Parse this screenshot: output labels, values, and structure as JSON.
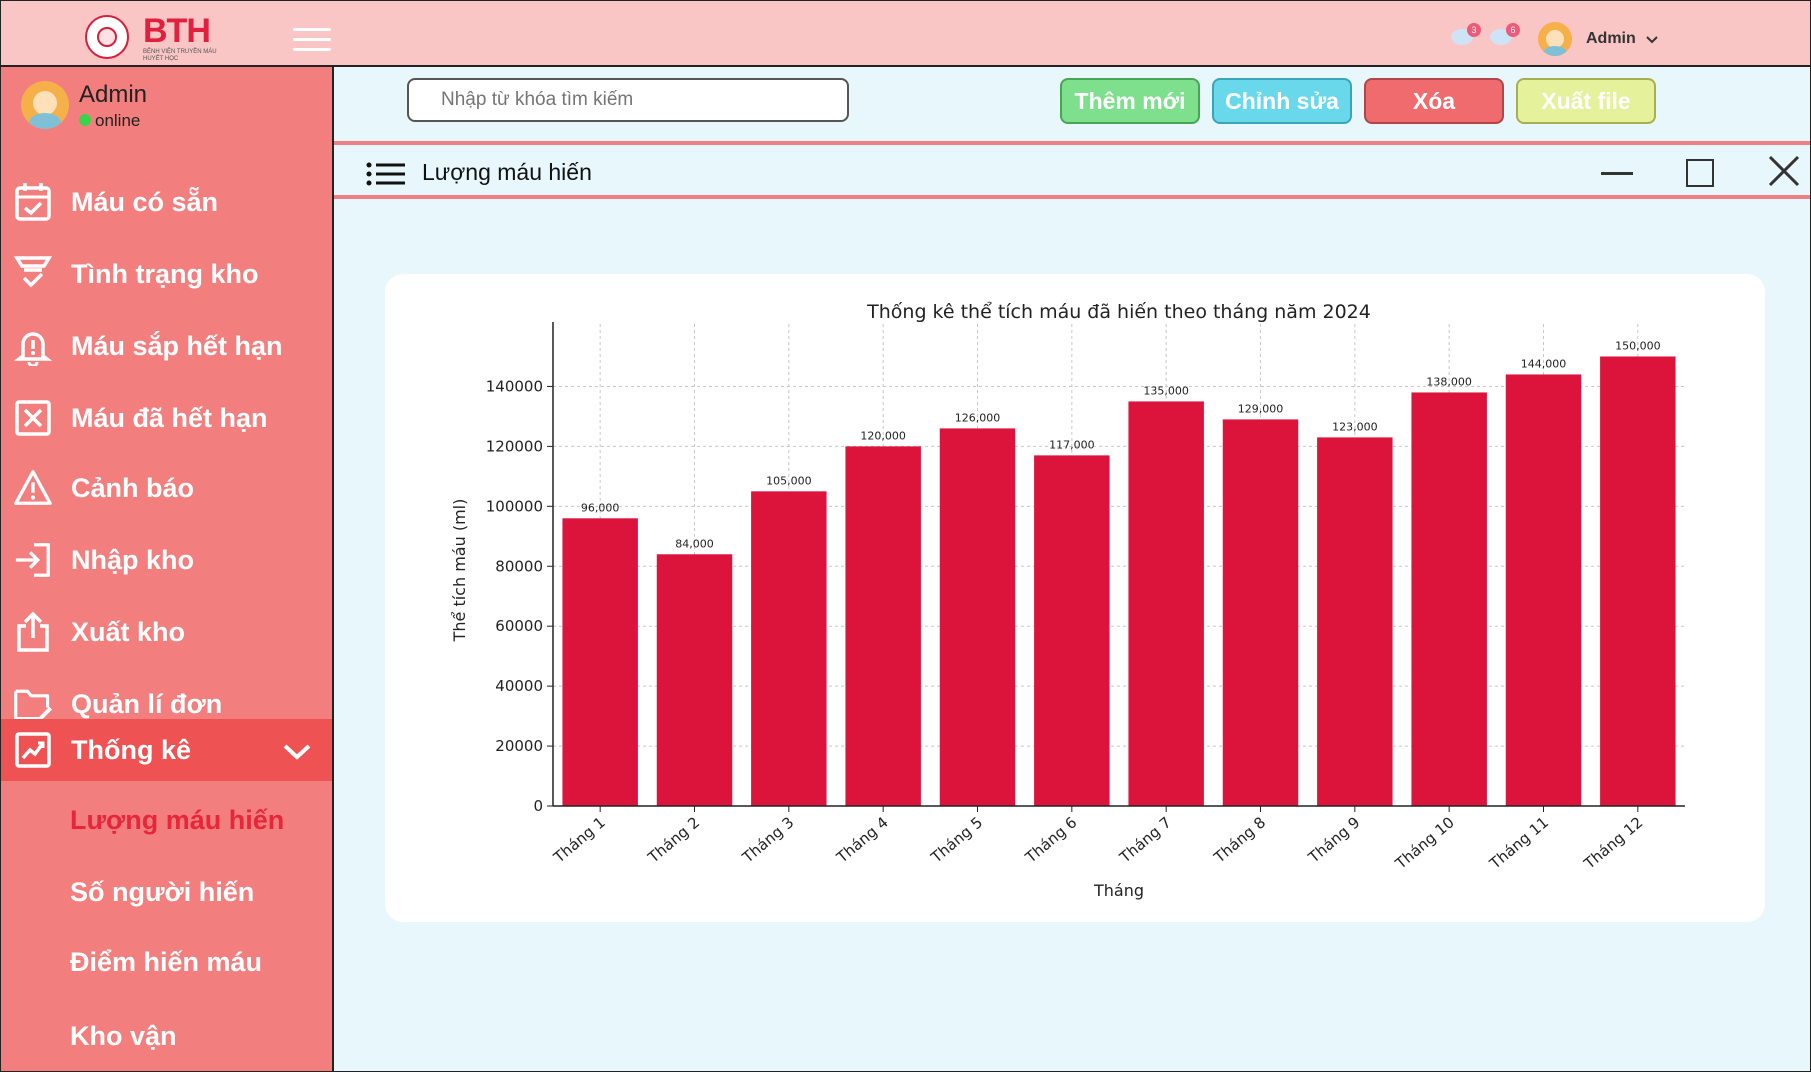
{
  "topbar": {
    "logo_text": "BTH",
    "logo_subtitle": "BỆNH VIỆN TRUYỀN MÁU HUYẾT HỌC",
    "notifications": [
      {
        "count": "3"
      },
      {
        "count": "6"
      }
    ],
    "user_name": "Admin"
  },
  "sidebar": {
    "profile": {
      "name": "Admin",
      "status": "online"
    },
    "items": [
      {
        "label": "Máu có sẵn",
        "icon": "calendar-check-icon"
      },
      {
        "label": "Tình trạng kho",
        "icon": "funnel-check-icon"
      },
      {
        "label": "Máu sắp hết hạn",
        "icon": "bell-alert-icon"
      },
      {
        "label": "Máu đã hết hạn",
        "icon": "x-square-icon"
      },
      {
        "label": "Cảnh báo",
        "icon": "warning-icon"
      },
      {
        "label": "Nhập kho",
        "icon": "import-icon"
      },
      {
        "label": "Xuất kho",
        "icon": "export-icon"
      },
      {
        "label": "Quản lí đơn",
        "icon": "folder-edit-icon"
      },
      {
        "label": "Thống kê",
        "icon": "chart-icon"
      }
    ],
    "subitems": [
      {
        "label": "Lượng máu hiến"
      },
      {
        "label": "Số người hiến"
      },
      {
        "label": "Điểm hiến máu"
      },
      {
        "label": "Kho vận"
      }
    ]
  },
  "toolbar": {
    "search_placeholder": "Nhập từ khóa tìm kiếm",
    "add_label": "Thêm mới",
    "edit_label": "Chỉnh sửa",
    "delete_label": "Xóa",
    "export_label": "Xuất file"
  },
  "window": {
    "title": "Lượng máu hiến"
  },
  "colors": {
    "bar": "#dc143c",
    "topbar": "#f9c5c5",
    "sidebar": "#f37e7e",
    "content_bg": "#e8f7fb"
  },
  "chart_data": {
    "type": "bar",
    "title": "Thống kê thể tích máu đã hiến theo tháng năm 2024",
    "xlabel": "Tháng",
    "ylabel": "Thể tích máu (ml)",
    "categories": [
      "Tháng 1",
      "Tháng 2",
      "Tháng 3",
      "Tháng 4",
      "Tháng 5",
      "Tháng 6",
      "Tháng 7",
      "Tháng 8",
      "Tháng 9",
      "Tháng 10",
      "Tháng 11",
      "Tháng 12"
    ],
    "values": [
      96000,
      84000,
      105000,
      120000,
      126000,
      117000,
      135000,
      129000,
      123000,
      138000,
      144000,
      150000
    ],
    "value_labels": [
      "96,000",
      "84,000",
      "105,000",
      "120,000",
      "126,000",
      "117,000",
      "135,000",
      "129,000",
      "123,000",
      "138,000",
      "144,000",
      "150,000"
    ],
    "yticks": [
      "0",
      "20000",
      "40000",
      "60000",
      "80000",
      "100000",
      "120000",
      "140000"
    ],
    "ylim": [
      0,
      157500
    ],
    "grid": true
  }
}
